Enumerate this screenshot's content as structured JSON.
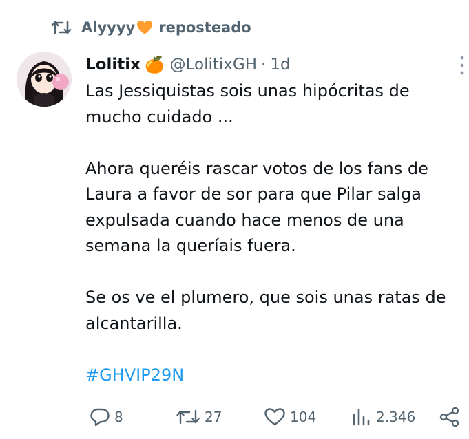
{
  "repost": {
    "user": "Alyyyy",
    "heart_icon": "orange-heart-icon",
    "action": "reposteado"
  },
  "tweet": {
    "display_name": "Lolitix",
    "emoji": "🍊",
    "handle": "@LolitixGH",
    "separator": "·",
    "time": "1d",
    "paragraphs": [
      [
        "Las Jessiquistas sois unas hipócritas de",
        "mucho cuidado ..."
      ],
      [
        "Ahora queréis rascar votos de los fans de",
        "Laura a favor de sor para que Pilar salga",
        "expulsada cuando hace menos de una",
        "semana la queríais fuera."
      ],
      [
        "Se os ve el plumero, que sois unas ratas de",
        "alcantarilla."
      ]
    ],
    "hashtag": "#GHVIP29N"
  },
  "actions": {
    "replies": "8",
    "reposts": "27",
    "likes": "104",
    "views": "2.346"
  },
  "colors": {
    "text": "#0f1419",
    "secondary": "#536471",
    "link": "#1d9bf0",
    "heart": "#ff9d2e"
  }
}
